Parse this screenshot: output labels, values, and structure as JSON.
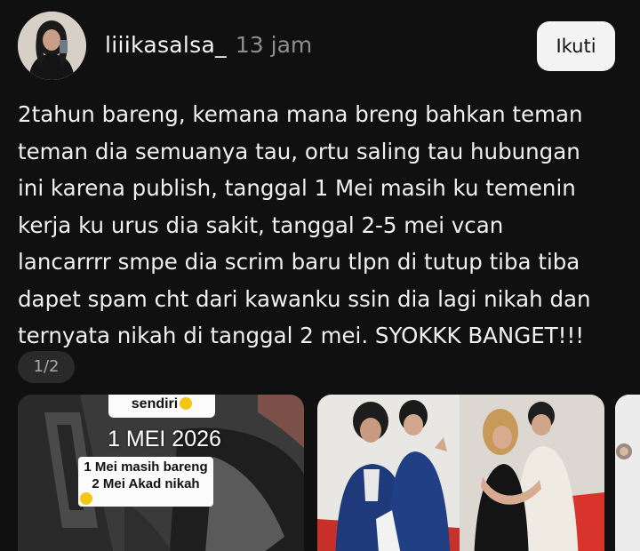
{
  "header": {
    "username": "liiikasalsa_",
    "timestamp": "13 jam",
    "follow_label": "Ikuti"
  },
  "caption": {
    "lines": [
      "2tahun bareng, kemana mana breng bahkan teman",
      "teman dia semuanya tau, ortu saling tau hubungan",
      "ini karena publish, tanggal 1 Mei masih ku temenin",
      "kerja ku urus dia sakit, tanggal 2-5 mei vcan",
      "lancarrrr smpe dia scrim baru tlpn di tutup tiba tiba",
      "dapet spam cht dari kawanku ssin dia lagi nikah dan",
      "ternyata nikah di tanggal 2 mei. SYOKKK BANGET!!!"
    ]
  },
  "page_indicator": "1/2",
  "carousel": {
    "photo1": {
      "sticker_top": "sendiri",
      "date_text": "1 MEI 2026",
      "note_lines": [
        "1 Mei masih bareng",
        "2 Mei Akad nikah"
      ]
    }
  },
  "colors": {
    "background": "#101010",
    "text": "#f0f0f0",
    "muted": "#8e8e8e",
    "button_bg": "#f3f3f3",
    "emoji": "#f5c518"
  }
}
